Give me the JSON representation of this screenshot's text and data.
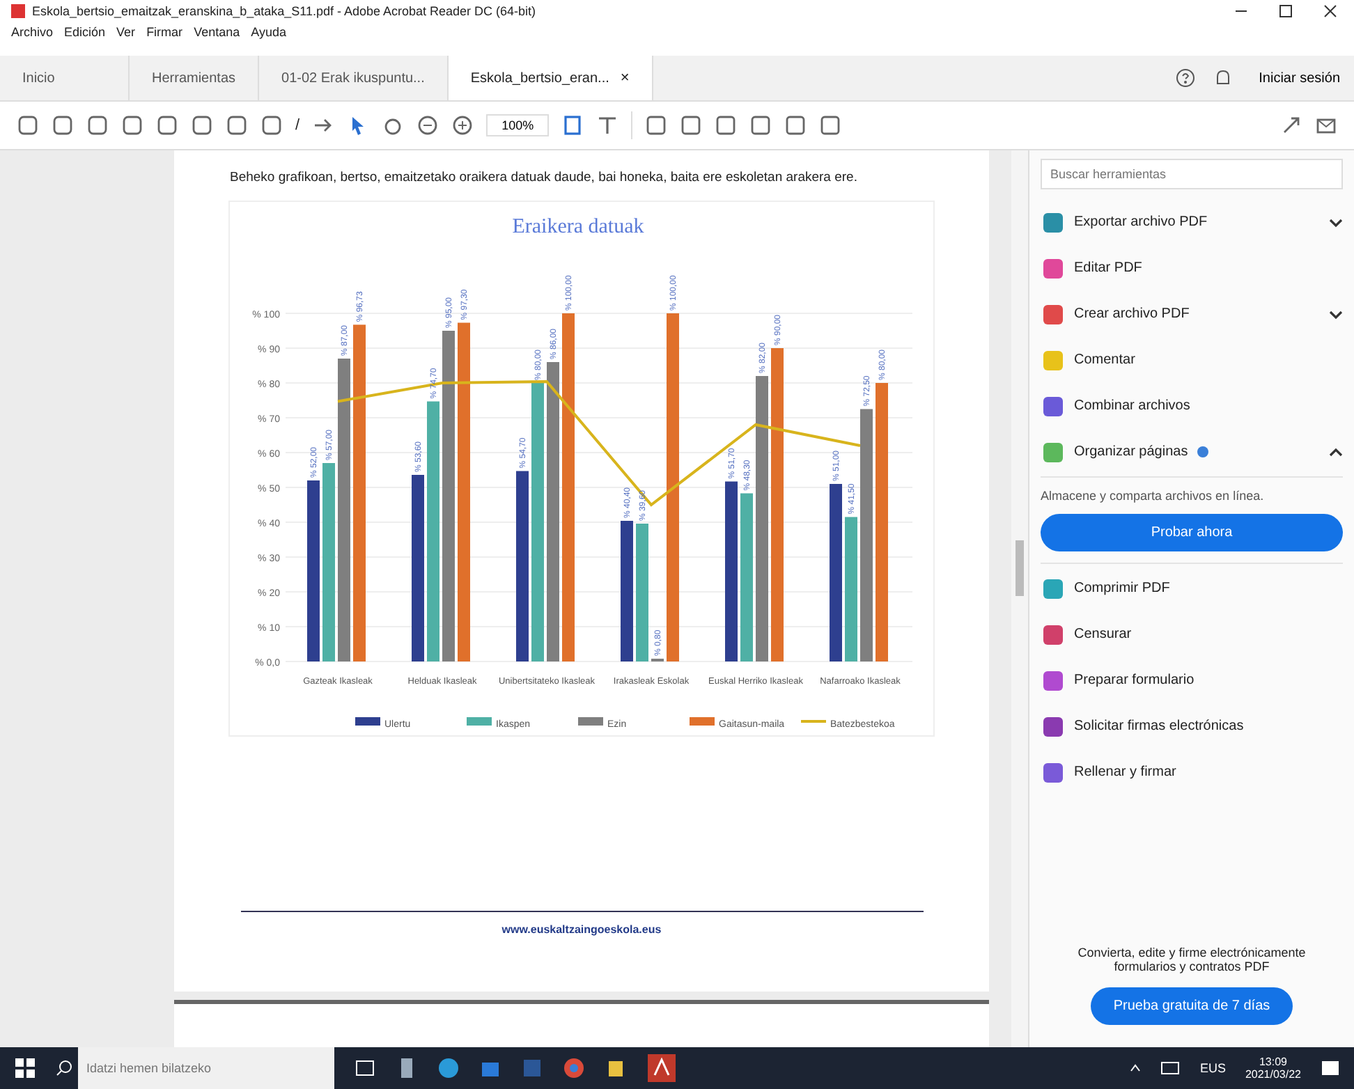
{
  "window": {
    "title": "Eskola_bertsio_emaitzak_eranskina_b_ataka_S11.pdf - Adobe Acrobat Reader DC (64-bit)"
  },
  "menu": [
    "Archivo",
    "Edición",
    "Ver",
    "Firmar",
    "Ventana",
    "Ayuda"
  ],
  "tabs": [
    {
      "label": "Inicio",
      "selected": false,
      "closable": false
    },
    {
      "label": "Herramientas",
      "selected": false,
      "closable": false
    },
    {
      "label": "01-02 Erak ikuspuntu...",
      "selected": false,
      "closable": false
    },
    {
      "label": "Eskola_bertsio_eran...",
      "selected": true,
      "closable": true
    }
  ],
  "close_glyph": "×",
  "sign_in": "Iniciar sesión",
  "toolbar": {
    "page_separator": "/",
    "zoom": "100%"
  },
  "document": {
    "paragraph": "Beheko grafikoan, bertso, emaitzetako oraikera datuak daude, bai honeka, baita ere eskoletan arakera ere.",
    "chart_data": {
      "type": "bar",
      "title": "Eraikera datuak",
      "categories": [
        "Gazteak Ikasleak",
        "Helduak Ikasleak",
        "Unibertsitateko Ikasleak",
        "Irakasleak Eskolak",
        "Euskal Herriko Ikasleak",
        "Nafarroako Ikasleak"
      ],
      "yticks": [
        {
          "value": 0,
          "label": "% 0,0"
        },
        {
          "value": 10,
          "label": "% 10"
        },
        {
          "value": 20,
          "label": "% 20"
        },
        {
          "value": 30,
          "label": "% 30"
        },
        {
          "value": 40,
          "label": "% 40"
        },
        {
          "value": 50,
          "label": "% 50"
        },
        {
          "value": 60,
          "label": "% 60"
        },
        {
          "value": 70,
          "label": "% 70"
        },
        {
          "value": 80,
          "label": "% 80"
        },
        {
          "value": 90,
          "label": "% 90"
        },
        {
          "value": 100,
          "label": "% 100"
        }
      ],
      "ylim": [
        0,
        100
      ],
      "series": [
        {
          "name": "Ulertu",
          "color": "#2e3f8f",
          "values": [
            52,
            53.6,
            54.7,
            40.4,
            51.7,
            51
          ],
          "value_labels": [
            "% 52,00",
            "% 53,60",
            "% 54,70",
            "% 40,40",
            "% 51,70",
            "% 51,00"
          ]
        },
        {
          "name": "Ikaspen",
          "color": "#4fb0a5",
          "values": [
            57,
            74.7,
            80,
            39.6,
            48.3,
            41.5
          ],
          "value_labels": [
            "% 57,00",
            "% 74,70",
            "% 80,00",
            "% 39,60",
            "% 48,30",
            "% 41,50"
          ]
        },
        {
          "name": "Ezin",
          "color": "#7f7f7f",
          "values": [
            87,
            95,
            86,
            0.8,
            82,
            72.5
          ],
          "value_labels": [
            "% 87,00",
            "% 95,00",
            "% 86,00",
            "% 0,80",
            "% 82,00",
            "% 72,50"
          ]
        },
        {
          "name": "Gaitasun-maila",
          "color": "#e0702b",
          "values": [
            96.73,
            97.3,
            100,
            100,
            90,
            80
          ],
          "value_labels": [
            "% 96,73",
            "% 97,30",
            "% 100,00",
            "% 100,00",
            "% 90,00",
            "% 80,00"
          ]
        },
        {
          "name": "Batezbestekoa",
          "color": "#d8b41c",
          "values": [
            74.7,
            80,
            80.4,
            45,
            68,
            62
          ],
          "type": "line"
        }
      ],
      "grid": true,
      "legend": true
    },
    "footer_link": "www.euskaltzaingoeskola.eus"
  },
  "tools_panel": {
    "search": {
      "placeholder": "Buscar herramientas"
    },
    "tools": [
      {
        "label": "Exportar archivo PDF",
        "color": "#2a8fa6",
        "kind": "menu",
        "expanded": false,
        "badge": false
      },
      {
        "label": "Editar PDF",
        "color": "#e0489a",
        "kind": "plain",
        "badge": false
      },
      {
        "label": "Crear archivo PDF",
        "color": "#e04a4a",
        "kind": "menu",
        "expanded": false,
        "badge": false
      },
      {
        "label": "Comentar",
        "color": "#e8c21a",
        "kind": "plain",
        "badge": false
      },
      {
        "label": "Combinar archivos",
        "color": "#6a5ad8",
        "kind": "plain",
        "badge": false
      },
      {
        "label": "Organizar páginas",
        "color": "#5cb85c",
        "kind": "menu",
        "expanded": true,
        "badge": true
      }
    ],
    "promo": "Almacene y comparta archivos en línea.",
    "promo_button": "Probar ahora",
    "more_tools": [
      {
        "label": "Comprimir PDF",
        "color": "#2aa6b6"
      },
      {
        "label": "Censurar",
        "color": "#d0406a"
      },
      {
        "label": "Preparar formulario",
        "color": "#b04ad0"
      },
      {
        "label": "Solicitar firmas electrónicas",
        "color": "#8a3ab0"
      },
      {
        "label": "Rellenar y firmar",
        "color": "#7a5ad8"
      }
    ],
    "footer_text": "Convierta, edite y firme electrónicamente formularios y contratos PDF",
    "trial_button": "Prueba gratuita de 7 días"
  },
  "taskbar": {
    "search": {
      "placeholder": "Idatzi hemen bilatzeko"
    },
    "language": "EUS",
    "time": "13:09",
    "date": "2021/03/22"
  }
}
